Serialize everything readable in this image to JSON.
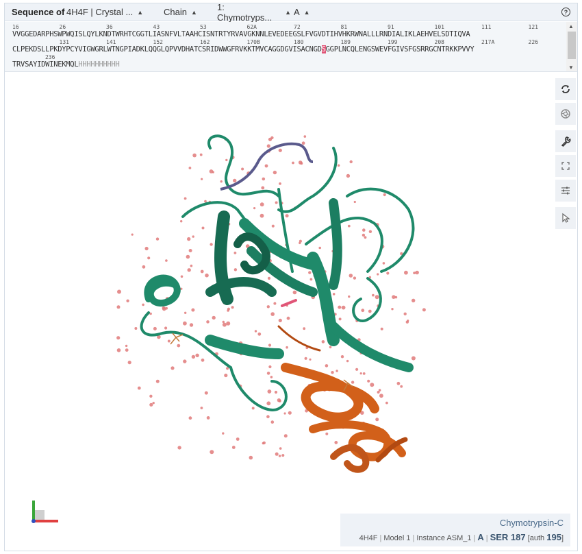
{
  "header": {
    "title": "Sequence of",
    "structure": "4H4F | Crystal ...",
    "mode": "Chain",
    "entity": "1: Chymotryps...",
    "asym": "A"
  },
  "sequence": {
    "lines": [
      {
        "numbers": [
          {
            "label": "16",
            "col": 0
          },
          {
            "label": "26",
            "col": 10
          },
          {
            "label": "36",
            "col": 20
          },
          {
            "label": "43",
            "col": 30
          },
          {
            "label": "53",
            "col": 40
          },
          {
            "label": "62A",
            "col": 50
          },
          {
            "label": "72",
            "col": 60
          },
          {
            "label": "81",
            "col": 70
          },
          {
            "label": "91",
            "col": 80
          },
          {
            "label": "101",
            "col": 90
          },
          {
            "label": "111",
            "col": 100
          },
          {
            "label": "121",
            "col": 110
          }
        ],
        "residues": "VVGGEDARPHSWPWQISLQYLKNDTWRHTCGGTLIASNFVLTAAHCISNTRTYRVAVGKNNLEVEDEEGSLFVGVDTIHVHKRWNALLLRNDIALIKLAEHVELSDTIQVA"
      },
      {
        "numbers": [
          {
            "label": "131",
            "col": 10
          },
          {
            "label": "141",
            "col": 20
          },
          {
            "label": "152",
            "col": 30
          },
          {
            "label": "162",
            "col": 40
          },
          {
            "label": "170B",
            "col": 50
          },
          {
            "label": "180",
            "col": 60
          },
          {
            "label": "189",
            "col": 70
          },
          {
            "label": "199",
            "col": 80
          },
          {
            "label": "208",
            "col": 90
          },
          {
            "label": "217A",
            "col": 100
          },
          {
            "label": "226",
            "col": 110
          }
        ],
        "residues_before": "CLPEKDSLLPKDYPCYVIGWGRLWTNGPIADKLQQGLQPVVDHATCSRIDWWGFRVKKTMVCAGGDGVISACNGD",
        "highlight": "S",
        "residues_after": "GGPLNCQLENGSWEVFGIVSFGSRRGCNTRKKPVVY"
      },
      {
        "numbers": [
          {
            "label": "236",
            "col": 7
          }
        ],
        "residues": "TRVSAYIDWINEKMQL",
        "tail": "HHHHHHHHHH"
      }
    ]
  },
  "toolbar": {
    "reset": "reset-view-icon",
    "screenshot": "camera-icon",
    "settings": "wrench-icon",
    "fullscreen": "expand-icon",
    "controls": "sliders-icon",
    "select": "pointer-icon"
  },
  "info": {
    "name": "Chymotrypsin-C",
    "entry": "4H4F",
    "model": "Model 1",
    "instance": "Instance ASM_1",
    "chain": "A",
    "residue": "SER 187",
    "auth_prefix": "[auth",
    "auth": "195",
    "auth_suffix": "]"
  },
  "colors": {
    "main_chain": "#1f8a6a",
    "secondary_chain": "#d2601a",
    "loop": "#5a5a8c",
    "highlight": "#e05577",
    "water": "#e07a7a"
  }
}
